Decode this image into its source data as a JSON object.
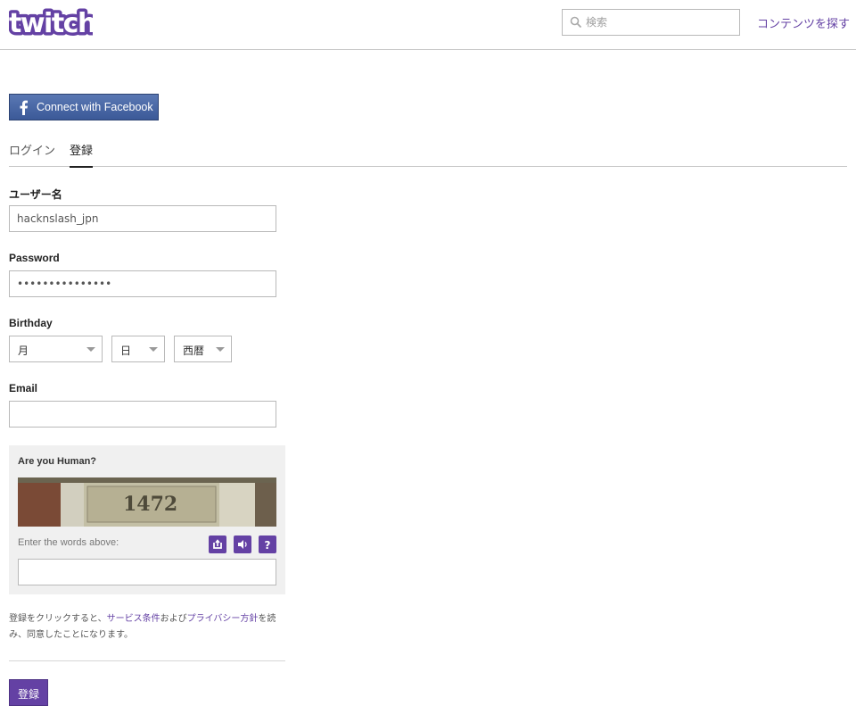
{
  "header": {
    "logo_text": "twitch",
    "search": {
      "placeholder": "検索"
    },
    "browse_link": "コンテンツを探す"
  },
  "facebook_button": {
    "label": "Connect with Facebook"
  },
  "tabs": [
    {
      "label": "ログイン",
      "active": false
    },
    {
      "label": "登録",
      "active": true
    }
  ],
  "form": {
    "username": {
      "label": "ユーザー名",
      "value": "hacknslash_jpn"
    },
    "password": {
      "label": "Password",
      "value": "•••••••••••••••"
    },
    "birthday": {
      "label": "Birthday",
      "month": "月",
      "day": "日",
      "year": "西暦"
    },
    "email": {
      "label": "Email",
      "value": ""
    }
  },
  "captcha": {
    "title": "Are you Human?",
    "image_text": "1472",
    "instruction": "Enter the words above:",
    "buttons": [
      "refresh-icon",
      "audio-icon",
      "help-icon"
    ],
    "value": ""
  },
  "terms": {
    "prefix": "登録をクリックすると、",
    "tos_link": "サービス条件",
    "middle": "および",
    "privacy_link": "プライバシー方針",
    "suffix": "を読み、同意したことになります。"
  },
  "submit": {
    "label": "登録"
  },
  "colors": {
    "brand": "#6441a4",
    "facebook": "#3b5998",
    "border": "#b9b9b9"
  }
}
